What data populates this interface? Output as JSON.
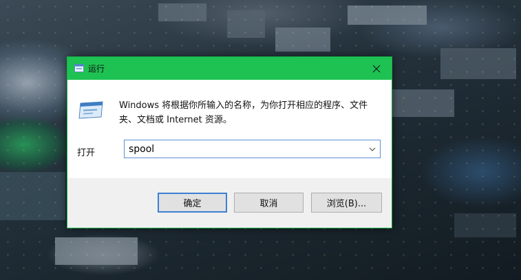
{
  "dialog": {
    "title": "运行",
    "description": "Windows 将根据你所输入的名称，为你打开相应的程序、文件夹、文档或 Internet 资源。",
    "open_label": "打开",
    "open_value": "spool",
    "buttons": {
      "ok": "确定",
      "cancel": "取消",
      "browse": "浏览(B)..."
    }
  },
  "icons": {
    "title": "run-icon",
    "close": "close-icon",
    "large": "run-program-icon",
    "dropdown": "chevron-down-icon"
  },
  "colors": {
    "titlebar": "#1ec252",
    "accent": "#3c7fd4"
  }
}
